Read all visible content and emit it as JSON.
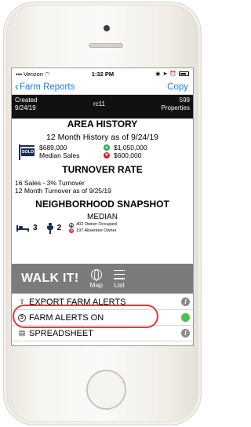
{
  "status_bar": {
    "carrier": "Verizon",
    "time": "1:32 PM"
  },
  "nav": {
    "back_label": "Farm Reports",
    "copy_label": "Copy"
  },
  "info_bar": {
    "created_label": "Created",
    "created_date": "9/24/19",
    "farm_id": "rc11",
    "properties_count": "599",
    "properties_label": "Properties"
  },
  "area_history": {
    "title": "AREA HISTORY",
    "subtitle": "12 Month History as of 9/24/19",
    "sold_sign_text": "SOLD",
    "median_value": "$689,000",
    "median_label": "Median Sales",
    "high_value": "$1,050,000",
    "low_value": "$600,000"
  },
  "turnover": {
    "title": "TURNOVER RATE",
    "line1": "16 Sales - 3% Turnover",
    "line2": "12 Month Turnover as of 9/25/19"
  },
  "snapshot": {
    "title": "NEIGHBORHOOD SNAPSHOT",
    "median_label": "MEDIAN",
    "beds": "3",
    "baths": "2",
    "owner_occupied": "402 Owner Occupied",
    "absentee_owner": "197 Absentee Owner"
  },
  "walk": {
    "title": "WALK IT!",
    "map_label": "Map",
    "list_label": "List"
  },
  "menu": [
    {
      "label": "EXPORT FARM ALERTS"
    },
    {
      "label": "FARM ALERTS ON"
    },
    {
      "label": "SPREADSHEET"
    }
  ],
  "colors": {
    "accent_blue": "#1a7cf0",
    "highlight_red": "#e23b36",
    "toggle_green": "#47c546"
  }
}
